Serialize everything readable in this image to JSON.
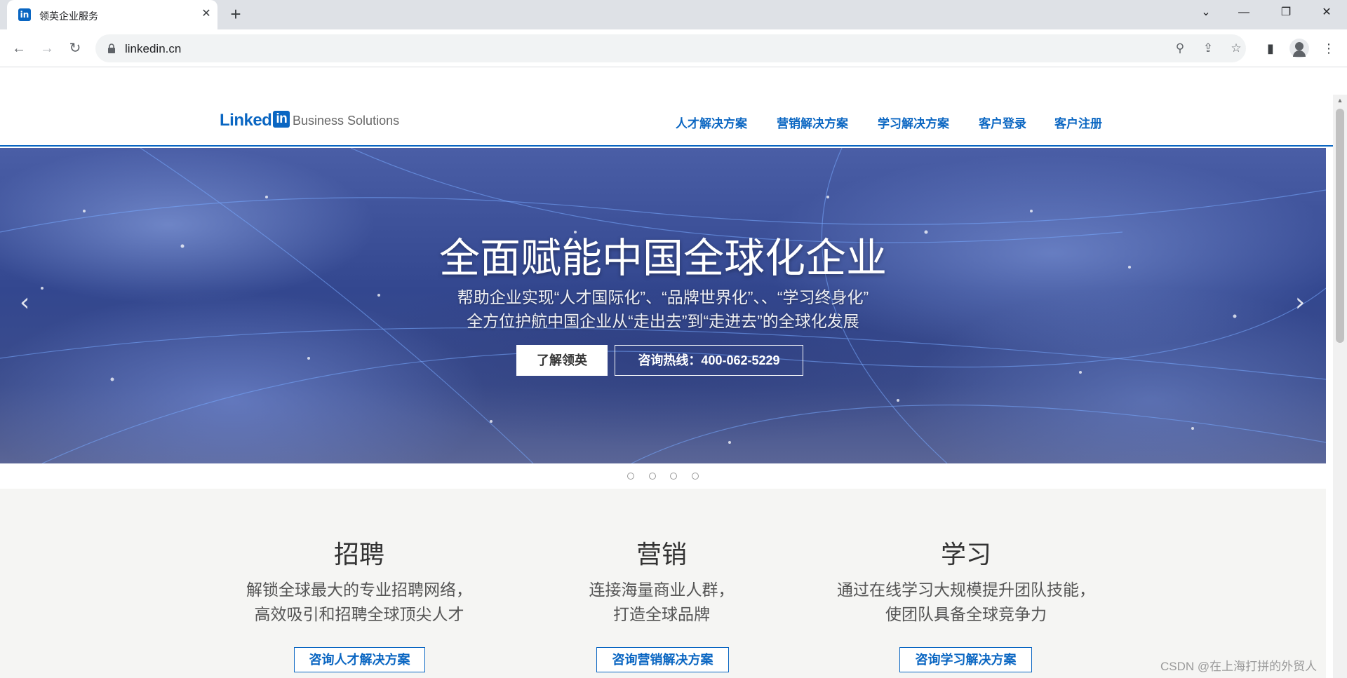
{
  "browser": {
    "tab_title": "领英企业服务",
    "favicon_text": "in",
    "new_tab_label": "+",
    "close_glyph": "✕",
    "url": "linkedin.cn"
  },
  "site": {
    "logo_text": "Linked",
    "logo_in": "in",
    "logo_sub": "Business Solutions",
    "nav": [
      {
        "label": "人才解决方案"
      },
      {
        "label": "营销解决方案"
      },
      {
        "label": "学习解决方案"
      },
      {
        "label": "客户登录"
      },
      {
        "label": "客户注册"
      }
    ]
  },
  "hero": {
    "title": "全面赋能中国全球化企业",
    "subtitle_line1": "帮助企业实现“人才国际化”、“品牌世界化”、、“学习终身化”",
    "subtitle_line2": "全方位护航中国企业从“走出去”到“走进去”的全球化发展",
    "btn_learn": "了解领英",
    "btn_hotline": "咨询热线：400-062-5229",
    "arrow_prev": "‹",
    "arrow_next": "›",
    "slide_count": 4
  },
  "services": [
    {
      "title": "招聘",
      "line1": "解锁全球最大的专业招聘网络，",
      "line2": "高效吸引和招聘全球顶尖人才",
      "button": "咨询人才解决方案"
    },
    {
      "title": "营销",
      "line1": "连接海量商业人群，",
      "line2": "打造全球品牌",
      "button": "咨询营销解决方案"
    },
    {
      "title": "学习",
      "line1": "通过在线学习大规模提升团队技能，",
      "line2": "使团队具备全球竞争力",
      "button": "咨询学习解决方案"
    }
  ],
  "watermark": "CSDN @在上海打拼的外贸人",
  "colors": {
    "brand": "#0a66c2",
    "hero_text": "#ffffff",
    "section_bg": "#f5f5f3"
  }
}
